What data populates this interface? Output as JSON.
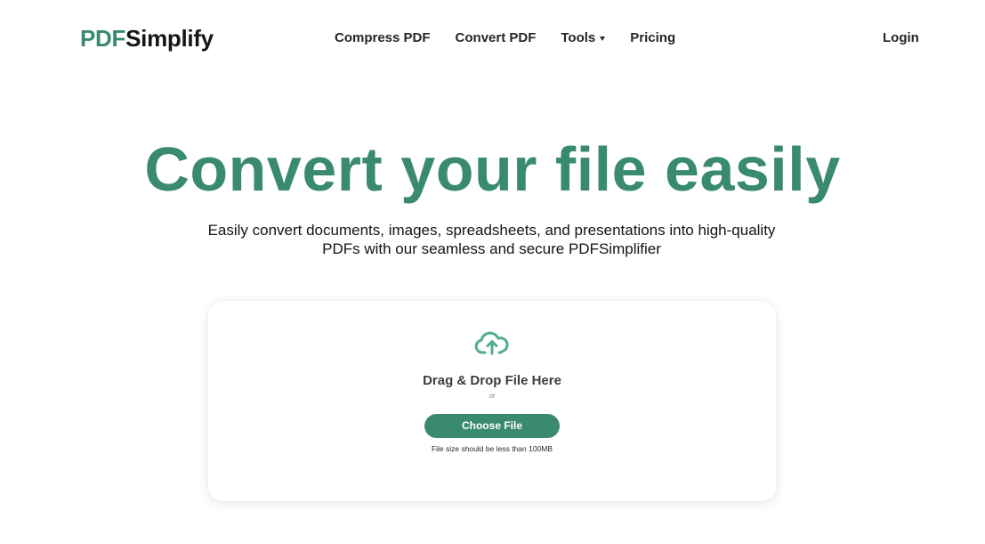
{
  "brand": {
    "logo_accent": "PDF",
    "logo_main": "Simplify",
    "accent_color": "#3a8a70"
  },
  "nav": {
    "items": [
      {
        "label": "Compress PDF",
        "has_dropdown": false
      },
      {
        "label": "Convert PDF",
        "has_dropdown": false
      },
      {
        "label": "Tools",
        "has_dropdown": true
      },
      {
        "label": "Pricing",
        "has_dropdown": false
      }
    ],
    "login_label": "Login"
  },
  "hero": {
    "title": "Convert your file easily",
    "subtitle_line1": "Easily convert documents, images, spreadsheets, and presentations into high-quality",
    "subtitle_line2": "PDFs with our seamless and secure PDFSimplifier"
  },
  "upload": {
    "icon": "cloud-upload-icon",
    "drop_label": "Drag & Drop File Here",
    "or_label": "or",
    "button_label": "Choose File",
    "size_note": "File size should be less than 100MB"
  }
}
